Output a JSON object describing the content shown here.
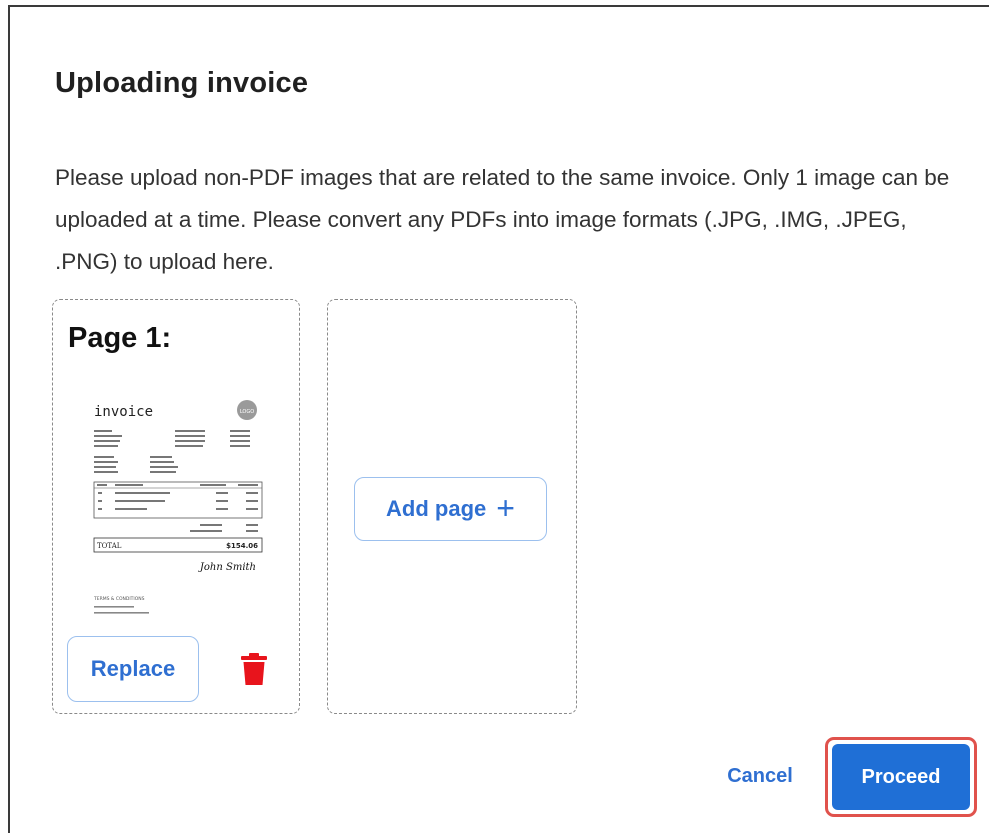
{
  "dialog": {
    "title": "Uploading invoice",
    "description": "Please upload non-PDF images that are related to the same invoice. Only 1 image can be uploaded at a time. Please convert any PDFs into image formats (.JPG, .IMG, .JPEG, .PNG) to upload here."
  },
  "pages": [
    {
      "label": "Page 1:",
      "thumbnail": {
        "heading": "invoice",
        "logo": "LOGO",
        "total_label": "TOTAL",
        "total_value": "$154.06",
        "signature": "John Smith",
        "terms": "TERMS & CONDITIONS"
      },
      "replace_label": "Replace",
      "delete_icon": "trash-icon"
    }
  ],
  "add_page": {
    "label": "Add page",
    "icon": "plus-icon"
  },
  "actions": {
    "cancel_label": "Cancel",
    "proceed_label": "Proceed"
  },
  "colors": {
    "accent": "#2f6fd1",
    "primary_button": "#1f6fd6",
    "delete": "#e8141c",
    "highlight_border": "#e0524c"
  }
}
